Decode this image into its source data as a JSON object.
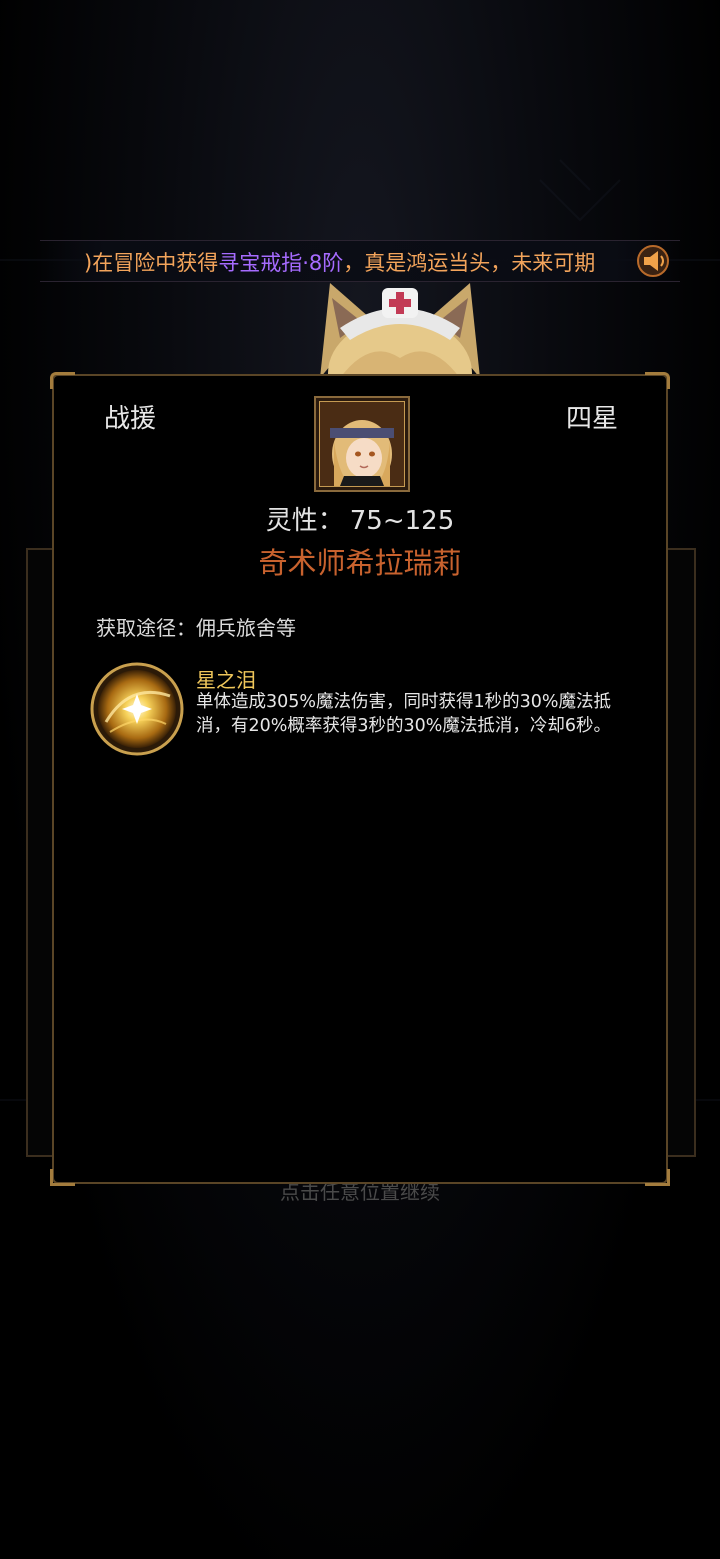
{
  "marquee": {
    "prefix": ")在冒险中获得",
    "item": "寻宝戒指·8阶",
    "suffix": "，真是鸿运当头，未来可期"
  },
  "dialog": {
    "type_label": "战援",
    "rank_label": "四星",
    "stat_label": "灵性：",
    "stat_value": "75~125",
    "name": "奇术师希拉瑞莉",
    "source_label": "获取途径：",
    "source_value": "佣兵旅舍等",
    "skill": {
      "name": "星之泪",
      "description": "单体造成305%魔法伤害，同时获得1秒的30%魔法抵消，有20%概率获得3秒的30%魔法抵消，冷却6秒。"
    }
  },
  "hint": "点击任意位置继续",
  "colors": {
    "name": "#c8622e",
    "skill_name": "#f0c75b",
    "marquee_text": "#f3a45b",
    "marquee_highlight": "#a66bff",
    "frame_gold": "#a37c3d"
  }
}
